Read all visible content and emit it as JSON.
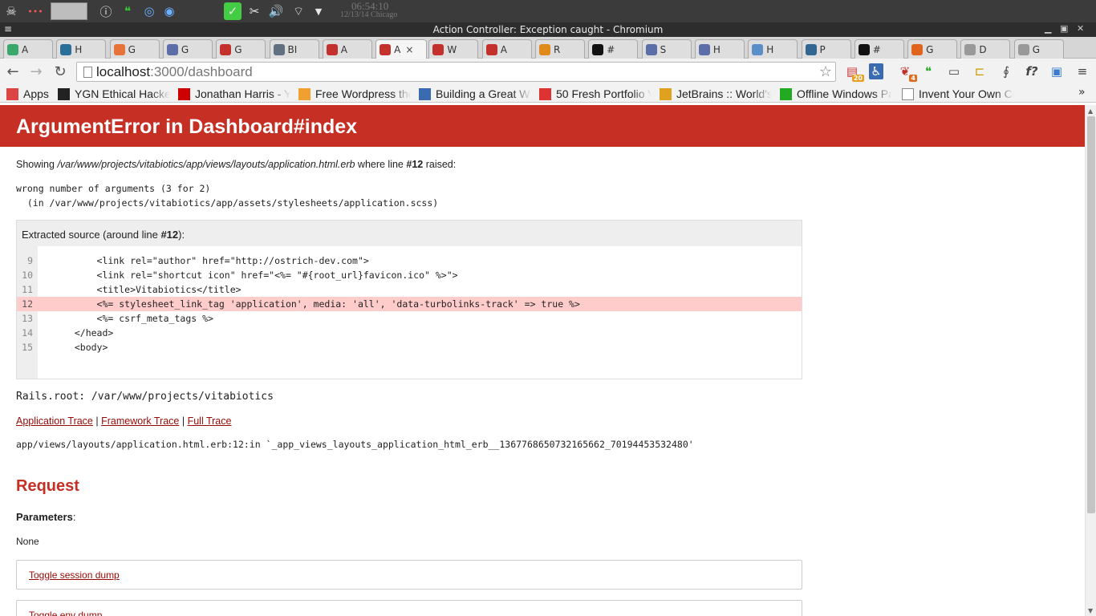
{
  "os": {
    "clock_time": "06:54:10",
    "clock_date": "12/13/14 Chicago"
  },
  "window": {
    "title": "Action Controller: Exception caught - Chromium"
  },
  "tabs": [
    {
      "label": "A",
      "icon": "chrome-like-icon",
      "color": "#3aa76d"
    },
    {
      "label": "H",
      "icon": "h-icon",
      "color": "#2a6f97"
    },
    {
      "label": "G",
      "icon": "plus-icon",
      "color": "#e8733a"
    },
    {
      "label": "G",
      "icon": "h-box-icon",
      "color": "#5b6ea8"
    },
    {
      "label": "G",
      "icon": "ruby-icon",
      "color": "#c4302b"
    },
    {
      "label": "BI",
      "icon": "doc-box-icon",
      "color": "#607080"
    },
    {
      "label": "A",
      "icon": "ruby-icon",
      "color": "#c4302b"
    },
    {
      "label": "A",
      "icon": "omega-icon",
      "color": "#c4302b",
      "active": true
    },
    {
      "label": "W",
      "icon": "ruby-icon",
      "color": "#c4302b"
    },
    {
      "label": "A",
      "icon": "ruby-icon",
      "color": "#c4302b"
    },
    {
      "label": "R",
      "icon": "arrows-icon",
      "color": "#e08a1e"
    },
    {
      "label": "#",
      "icon": "r-icon",
      "color": "#111"
    },
    {
      "label": "S",
      "icon": "h-box-icon",
      "color": "#5b6ea8"
    },
    {
      "label": "H",
      "icon": "h-box-icon",
      "color": "#5b6ea8"
    },
    {
      "label": "H",
      "icon": "cloud-icon",
      "color": "#5a8fc8"
    },
    {
      "label": "P",
      "icon": "elephant-icon",
      "color": "#336791"
    },
    {
      "label": "#",
      "icon": "r-icon",
      "color": "#111"
    },
    {
      "label": "G",
      "icon": "five-icon",
      "color": "#e0641e"
    },
    {
      "label": "D",
      "icon": "page-icon",
      "color": "#999"
    },
    {
      "label": "G",
      "icon": "page-icon",
      "color": "#999"
    }
  ],
  "active_tab_close": "×",
  "address": {
    "host": "localhost",
    "path": ":3000/dashboard"
  },
  "extensions": {
    "badge_20": "20",
    "badge_4": "4"
  },
  "bookmarks": [
    {
      "label": "Apps",
      "color": "#d44"
    },
    {
      "label": "YGN Ethical Hacke",
      "color": "#222"
    },
    {
      "label": "Jonathan Harris - Y",
      "color": "#c00"
    },
    {
      "label": "Free Wordpress the",
      "color": "#f0a030"
    },
    {
      "label": "Building a Great W",
      "color": "#3a6ab0"
    },
    {
      "label": "50 Fresh Portfolio V",
      "color": "#d33"
    },
    {
      "label": "JetBrains :: World's",
      "color": "#e0a020"
    },
    {
      "label": "Offline Windows Pa",
      "color": "#2a2"
    },
    {
      "label": "Invent Your Own Co",
      "color": "#fff"
    }
  ],
  "bookmarks_overflow": "»",
  "error": {
    "heading": "ArgumentError in Dashboard#index",
    "showing_prefix": "Showing ",
    "showing_file": "/var/www/projects/vitabiotics/app/views/layouts/application.html.erb",
    "showing_mid": " where line ",
    "showing_line": "#12",
    "showing_suffix": " raised:",
    "message_line1": "wrong number of arguments (3 for 2)",
    "message_line2": "  (in /var/www/projects/vitabiotics/app/assets/stylesheets/application.scss)",
    "extracted_prefix": "Extracted source (around line ",
    "extracted_line": "#12",
    "extracted_suffix": "):",
    "source_lines": [
      {
        "num": "9",
        "code": "      <link rel=\"author\" href=\"http://ostrich-dev.com\">"
      },
      {
        "num": "10",
        "code": "      <link rel=\"shortcut icon\" href=\"<%= \"#{root_url}favicon.ico\" %>\">"
      },
      {
        "num": "11",
        "code": "      <title>Vitabiotics</title>"
      },
      {
        "num": "12",
        "code": "      <%= stylesheet_link_tag 'application', media: 'all', 'data-turbolinks-track' => true %>",
        "highlight": true
      },
      {
        "num": "13",
        "code": "      <%= csrf_meta_tags %>"
      },
      {
        "num": "14",
        "code": "  </head>"
      },
      {
        "num": "15",
        "code": "  <body>"
      }
    ],
    "rails_root": "Rails.root: /var/www/projects/vitabiotics",
    "trace_links": [
      "Application Trace",
      "Framework Trace",
      "Full Trace"
    ],
    "trace_sep": "|",
    "trace_line": "app/views/layouts/application.html.erb:12:in `_app_views_layouts_application_html_erb__1367768650732165662_70194453532480'"
  },
  "request": {
    "heading": "Request",
    "params_label": "Parameters",
    "params_colon": ":",
    "params_value": "None",
    "toggle_session": "Toggle session dump",
    "toggle_env": "Toggle env dump"
  }
}
